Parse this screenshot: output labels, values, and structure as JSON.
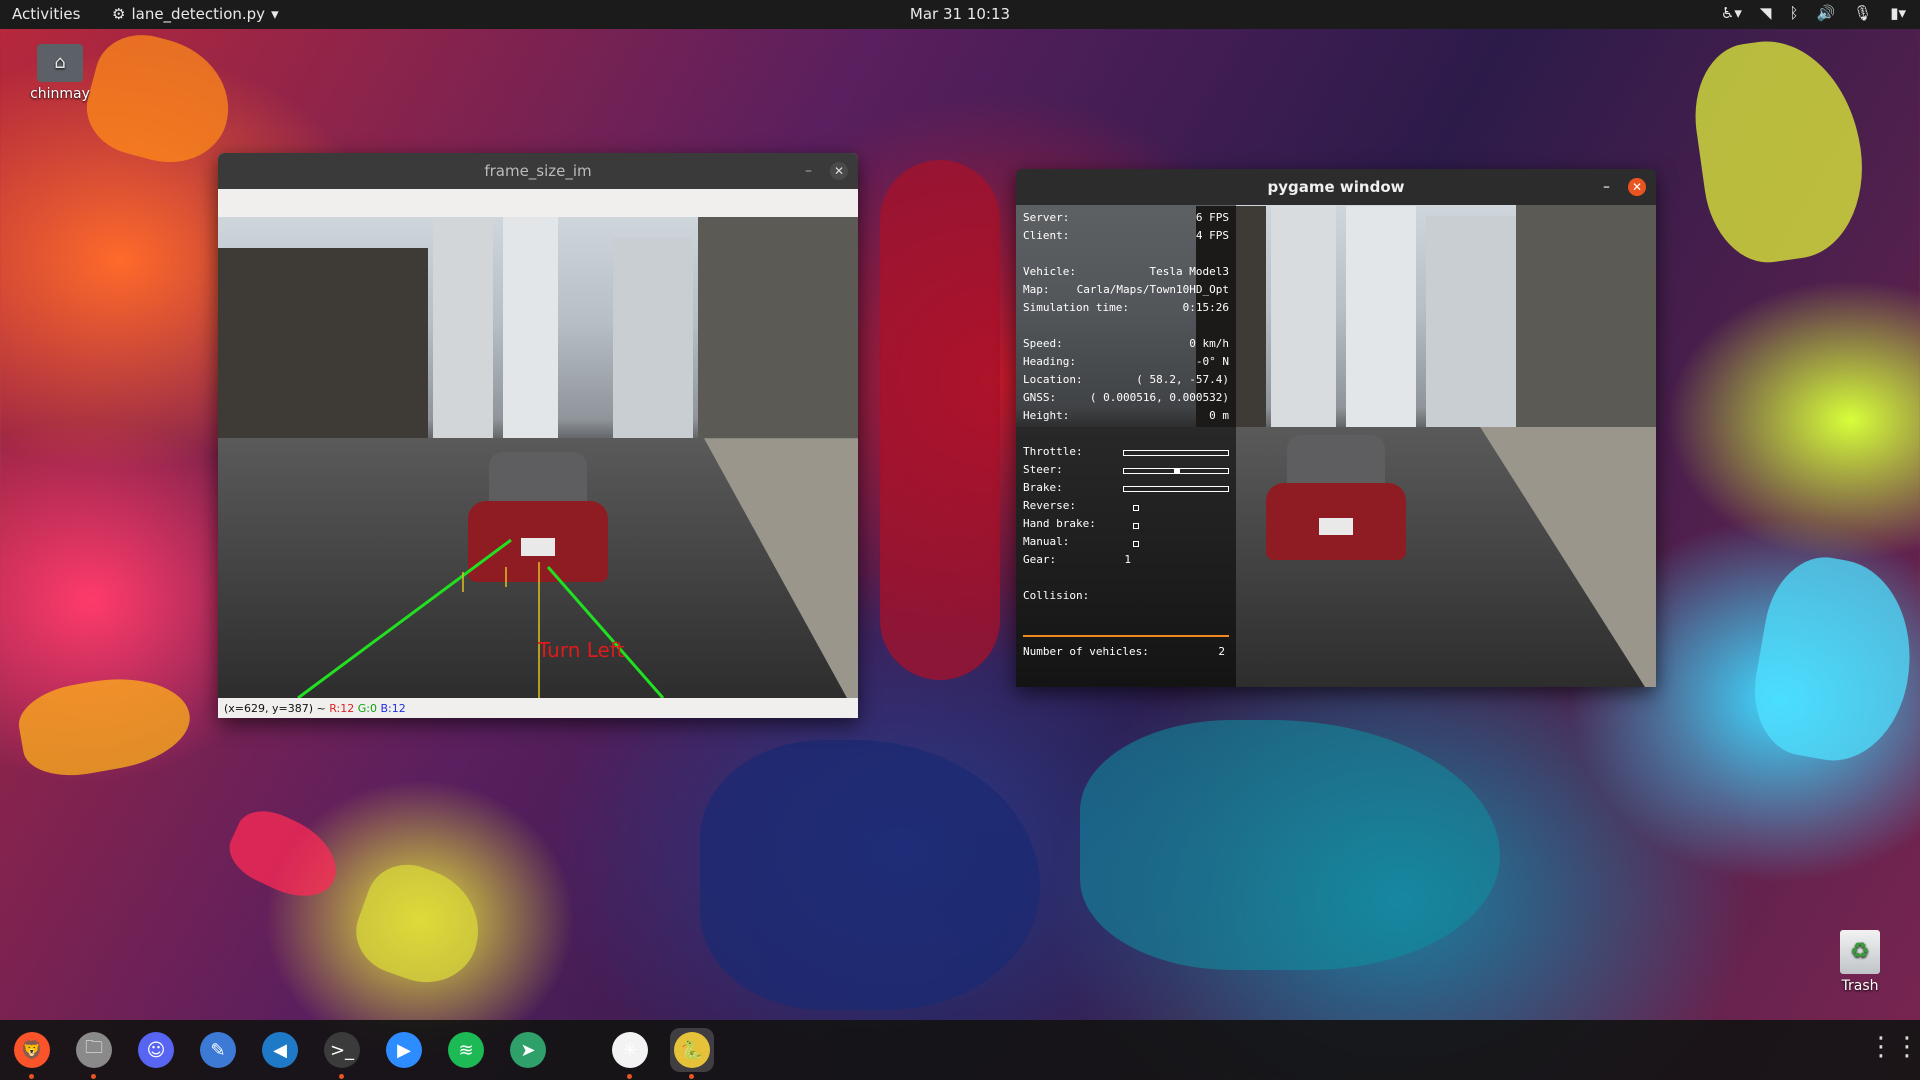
{
  "topbar": {
    "activities": "Activities",
    "app_name": "lane_detection.py",
    "clock": "Mar 31  10:13"
  },
  "desktop": {
    "home_label": "chinmay",
    "trash_label": "Trash"
  },
  "cv_window": {
    "title": "frame_size_im",
    "overlay_text": "Turn Left",
    "status_prefix": "(x=629, y=387) ~",
    "status_r": "R:12",
    "status_g": "G:0",
    "status_b": "B:12"
  },
  "pygame_window": {
    "title": "pygame window",
    "hud": {
      "server_label": "Server:",
      "server_value": "6 FPS",
      "client_label": "Client:",
      "client_value": "4 FPS",
      "vehicle_label": "Vehicle:",
      "vehicle_value": "Tesla Model3",
      "map_label": "Map:",
      "map_value": "Carla/Maps/Town10HD_Opt",
      "simtime_label": "Simulation time:",
      "simtime_value": "0:15:26",
      "speed_label": "Speed:",
      "speed_value": "0 km/h",
      "heading_label": "Heading:",
      "heading_value": "-0° N",
      "location_label": "Location:",
      "location_value": "( 58.2, -57.4)",
      "gnss_label": "GNSS:",
      "gnss_value": "( 0.000516,  0.000532)",
      "height_label": "Height:",
      "height_value": "0 m",
      "throttle_label": "Throttle:",
      "throttle_value": 0.0,
      "steer_label": "Steer:",
      "steer_value": 0.0,
      "brake_label": "Brake:",
      "brake_value": 0.0,
      "reverse_label": "Reverse:",
      "handbrake_label": "Hand brake:",
      "manual_label": "Manual:",
      "gear_label": "Gear:",
      "gear_value": "1",
      "collision_label": "Collision:",
      "vehicles_label": "Number of vehicles:",
      "vehicles_value": "2"
    }
  },
  "dock": {
    "apps": [
      {
        "name": "brave",
        "glyph": "🦁",
        "color": "#fb542b",
        "running": true
      },
      {
        "name": "files",
        "glyph": "🗀",
        "color": "#8a8a8a",
        "running": true
      },
      {
        "name": "discord",
        "glyph": "☺",
        "color": "#5865f2",
        "running": false
      },
      {
        "name": "text-editor",
        "glyph": "✎",
        "color": "#3d7ad6",
        "running": false
      },
      {
        "name": "vscode",
        "glyph": "◀",
        "color": "#1e7ac6",
        "running": false
      },
      {
        "name": "terminal",
        "glyph": ">_",
        "color": "#3b3b3b",
        "running": true
      },
      {
        "name": "zoom",
        "glyph": "▶",
        "color": "#2d8cff",
        "running": false
      },
      {
        "name": "spotify",
        "glyph": "≋",
        "color": "#1db954",
        "running": false
      },
      {
        "name": "telegram-like",
        "glyph": "➤",
        "color": "#2fa06a",
        "running": false
      },
      {
        "name": "carla",
        "glyph": "✳",
        "color": "#f3f3f3",
        "running": true
      },
      {
        "name": "pygame",
        "glyph": "🐍",
        "color": "#e6c23a",
        "running": true
      }
    ]
  },
  "colors": {
    "ubuntu_orange": "#e95420",
    "lane_green": "#20e020",
    "overlay_red": "#e01a1a"
  }
}
